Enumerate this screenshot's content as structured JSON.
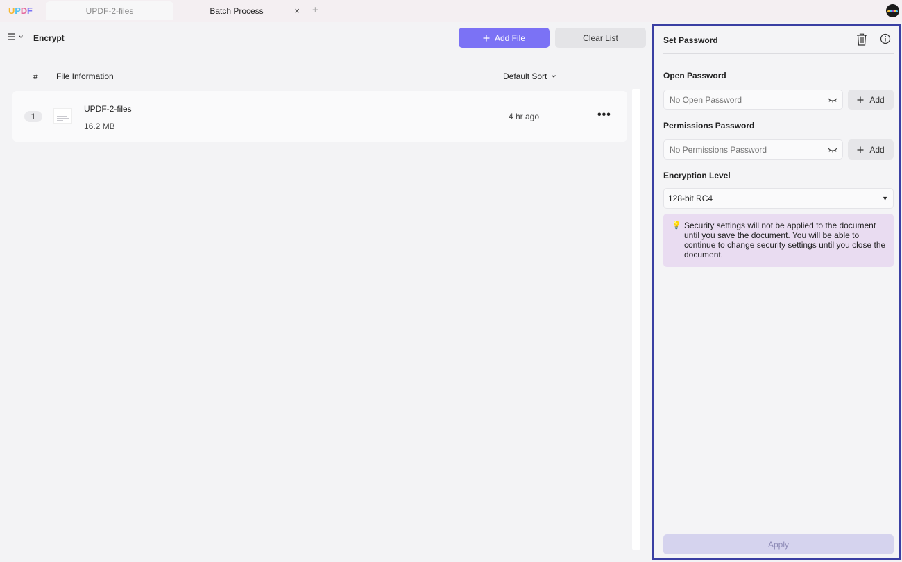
{
  "titlebar": {
    "logo": "UPDF",
    "logo_colors": [
      "#f7b731",
      "#55c3f2",
      "#e56b9f",
      "#7b72f5"
    ],
    "tabs": [
      {
        "label": "UPDF-2-files",
        "active": false
      },
      {
        "label": "Batch Process",
        "active": true,
        "close_icon": "×"
      }
    ],
    "add_tab_icon": "+"
  },
  "toolbar": {
    "heading": "Encrypt",
    "add_file_label": "Add File",
    "clear_list_label": "Clear List",
    "accent_color": "#7b72f5"
  },
  "table": {
    "headers": {
      "number": "#",
      "info": "File Information",
      "sort": "Default Sort"
    },
    "rows": [
      {
        "number": "1",
        "name": "UPDF-2-files",
        "size": "16.2 MB",
        "time": "4 hr ago",
        "more": "•••"
      }
    ]
  },
  "panel": {
    "title": "Set Password",
    "open_password": {
      "label": "Open Password",
      "placeholder": "No Open Password",
      "add_label": "Add"
    },
    "permissions_password": {
      "label": "Permissions Password",
      "placeholder": "No Permissions Password",
      "add_label": "Add"
    },
    "encryption": {
      "label": "Encryption Level",
      "value": "128-bit RC4",
      "caret": "▼"
    },
    "note": {
      "icon": "💡",
      "text": "Security settings will not be applied to the document until you save the document. You will be able to continue to change security settings until you close the document."
    },
    "apply_label": "Apply"
  }
}
